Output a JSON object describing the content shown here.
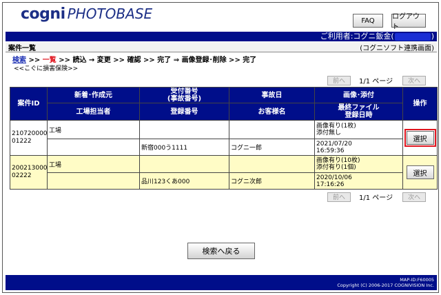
{
  "logo": {
    "part1": "cogni",
    "part2": "PHOTOBASE"
  },
  "header": {
    "faq_label": "FAQ",
    "logout_label": "ログアウト"
  },
  "userbar": {
    "prefix": "ご利用者:コグニ鈑金(",
    "suffix": ")"
  },
  "titlebar": {
    "title": "案件一覧",
    "company": "(コグニソフト連携画面)"
  },
  "steps": {
    "search": "検索",
    "sep1": " >> ",
    "list": "一覧",
    "rest": " >> 読込 → 変更 >> 確認 >> 完了 ⇒ 画像登録･削除 >> 完了"
  },
  "subtitle": "<<こぐに損害保険>>",
  "pager": {
    "prev": "前へ",
    "info": "1/1 ページ",
    "next": "次へ"
  },
  "table": {
    "headers": {
      "id": "案件ID",
      "creator": "新着･作成元",
      "factory_staff": "工場担当者",
      "receipt_no": "受付番号",
      "accident_no": "(事故番号)",
      "reg_no": "登録番号",
      "accident_date": "事故日",
      "customer": "お客様名",
      "image": "画像･添付",
      "last_file": "最終ファイル",
      "reg_date": "登録日時",
      "op": "操作"
    },
    "rows": [
      {
        "id_line1": "2107200000",
        "id_line2": "01222",
        "creator": "工場",
        "staff": "",
        "receipt": "",
        "reg_no": "新宿000う1111",
        "accident_date": "",
        "customer": "コグニ一郎",
        "image_line1": "画像有り(1枚)",
        "image_line2": "添付無し",
        "date_line1": "2021/07/20",
        "date_line2": "16:59:36",
        "op": "選択"
      },
      {
        "id_line1": "2002130000",
        "id_line2": "02222",
        "creator": "工場",
        "staff": "",
        "receipt": "",
        "reg_no": "品川123くあ000",
        "accident_date": "",
        "customer": "コグニ次郎",
        "image_line1": "画像有り(10枚)",
        "image_line2": "添付有り(1個)",
        "date_line1": "2020/10/06",
        "date_line2": "17:16:26",
        "op": "選択"
      }
    ]
  },
  "back_label": "検索へ戻る",
  "footer": {
    "map_id": "MAP-ID:F60005",
    "copyright": "Copyright (C) 2006-2017 COGNIVISION Inc."
  },
  "colors": {
    "navy": "#000e8a",
    "yellow_row": "#fffcc6",
    "highlight": "#e0141e"
  }
}
